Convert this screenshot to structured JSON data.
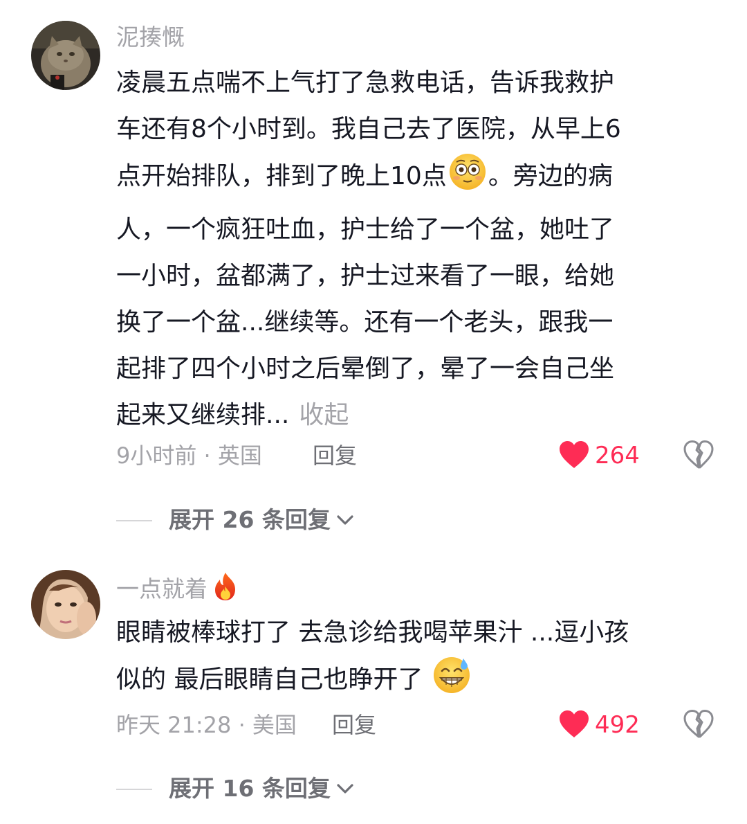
{
  "comments": [
    {
      "username": "泥揍慨",
      "text_lines": [
        "凌晨五点喘不上气打了急救电话，告诉我救护",
        "车还有8个小时到。我自己去了医院，从早上6",
        "点开始排队，排到了晚上10点",
        "。旁边的病",
        "人，一个疯狂吐血，护士给了一个盆，她吐了",
        "一小时，盆都满了，护士过来看了一眼，给她",
        "换了一个盆...继续等。还有一个老头，跟我一",
        "起排了四个小时之后晕倒了，晕了一会自己坐",
        "起来又继续排..."
      ],
      "inline_emoji": "flushed-face",
      "collapse_label": "收起",
      "time_location": "9小时前 · 英国",
      "reply_label": "回复",
      "likes": "264",
      "expand_label": "展开 26 条回复"
    },
    {
      "username": "一点就着",
      "username_emoji": "fire",
      "text_lines": [
        "眼睛被棒球打了 去急诊给我喝苹果汁 ...逗小孩",
        "似的 最后眼睛自己也睁开了"
      ],
      "inline_emoji": "grimacing-sweat-face",
      "time_location": "昨天 21:28 · 美国",
      "reply_label": "回复",
      "likes": "492",
      "expand_label": "展开 16 条回复"
    }
  ],
  "colors": {
    "like_red": "#fe2c55",
    "muted_text": "#a3a3a8",
    "body_text": "#161823",
    "secondary_text": "#6e6f75"
  },
  "icons": {
    "like": "heart-icon",
    "dislike": "broken-heart-icon",
    "expand": "chevron-down-icon"
  }
}
